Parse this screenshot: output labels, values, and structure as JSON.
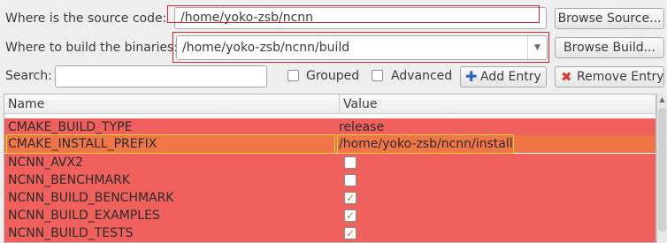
{
  "source": {
    "label": "Where is the source code:",
    "value": "/home/yoko-zsb/ncnn",
    "browse_label": "Browse Source..."
  },
  "build": {
    "label": "Where to build the binaries:",
    "value": "/home/yoko-zsb/ncnn/build",
    "browse_label": "Browse Build..."
  },
  "search": {
    "label": "Search:",
    "value": ""
  },
  "options": {
    "grouped_label": "Grouped",
    "advanced_label": "Advanced",
    "grouped_checked": false,
    "advanced_checked": false
  },
  "actions": {
    "add_entry_label": "Add Entry",
    "remove_entry_label": "Remove Entry"
  },
  "table": {
    "headers": [
      "Name",
      "Value"
    ],
    "rows": [
      {
        "name": "CMAKE_BUILD_TYPE",
        "value": "release",
        "type": "text"
      },
      {
        "name": "CMAKE_INSTALL_PREFIX",
        "value": "/home/yoko-zsb/ncnn/install",
        "type": "text",
        "selected": true
      },
      {
        "name": "NCNN_AVX2",
        "checked": false,
        "type": "bool"
      },
      {
        "name": "NCNN_BENCHMARK",
        "checked": false,
        "type": "bool"
      },
      {
        "name": "NCNN_BUILD_BENCHMARK",
        "checked": true,
        "type": "bool"
      },
      {
        "name": "NCNN_BUILD_EXAMPLES",
        "checked": true,
        "type": "bool"
      },
      {
        "name": "NCNN_BUILD_TESTS",
        "checked": true,
        "type": "bool"
      }
    ]
  },
  "colors": {
    "row_changed": "#f0605c",
    "row_selected": "#f07648",
    "highlight_box": "#d22a2a",
    "selection_outline": "#f3d23b"
  }
}
